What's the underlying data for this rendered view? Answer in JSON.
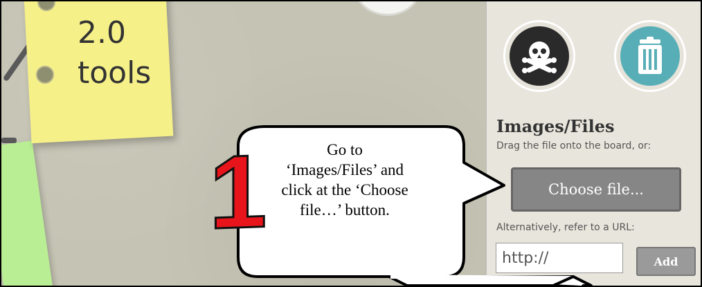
{
  "board": {
    "sticky_note": {
      "line1": "2.0",
      "line2": "tools"
    }
  },
  "panel": {
    "heading": "Images/Files",
    "drag_text": "Drag the file onto the board, or:",
    "choose_button_label": "Choose file...",
    "alt_text": "Alternatively, refer to a URL:",
    "url_input_value": "http://",
    "add_button_label": "Add",
    "icons": [
      "skull-icon",
      "trash-icon"
    ]
  },
  "annotation": {
    "step_number": "1",
    "callout_lines": [
      "Go to",
      "‘Images/Files’ and",
      "click at the ‘Choose",
      "file…’ button."
    ]
  },
  "colors": {
    "board": "#c5c3b3",
    "sticky_yellow": "#f6f089",
    "sticky_green": "#b9ee95",
    "panel": "#e8e5dc",
    "choose_button": "#868686",
    "trash_button": "#58aeb7",
    "skull_button": "#2a2a2a",
    "step_number": "#e8141b"
  }
}
